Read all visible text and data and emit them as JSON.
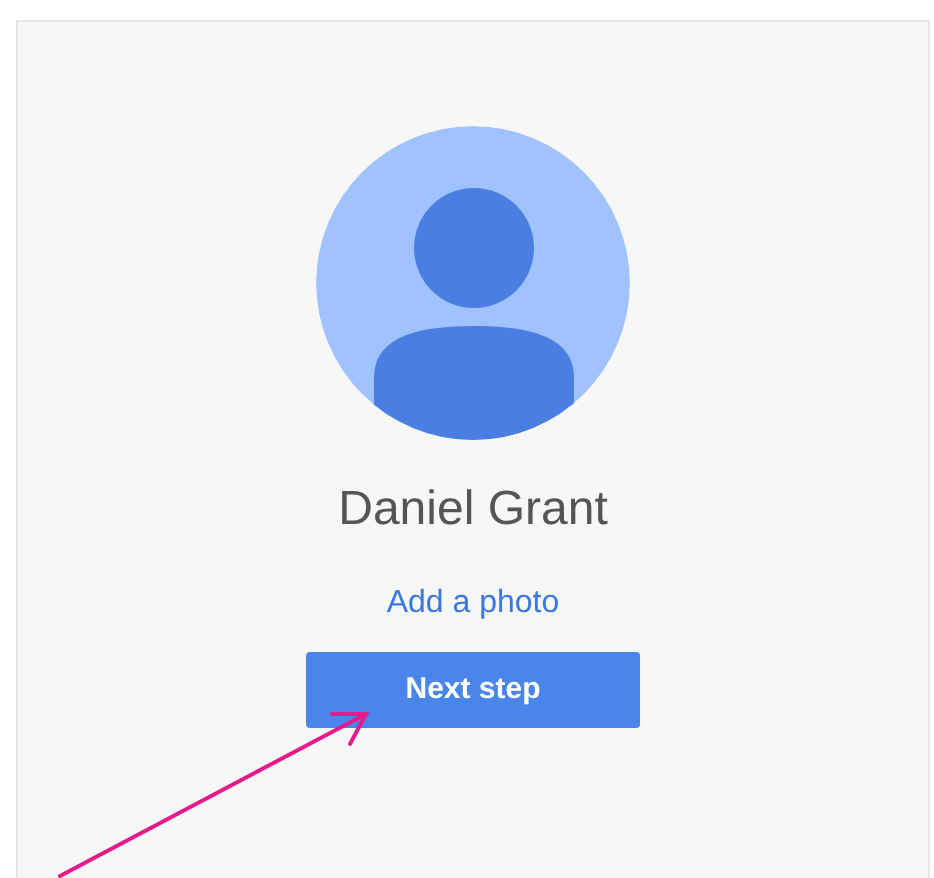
{
  "profile": {
    "name": "Daniel Grant",
    "add_photo_link": "Add a photo",
    "next_button": "Next step"
  }
}
